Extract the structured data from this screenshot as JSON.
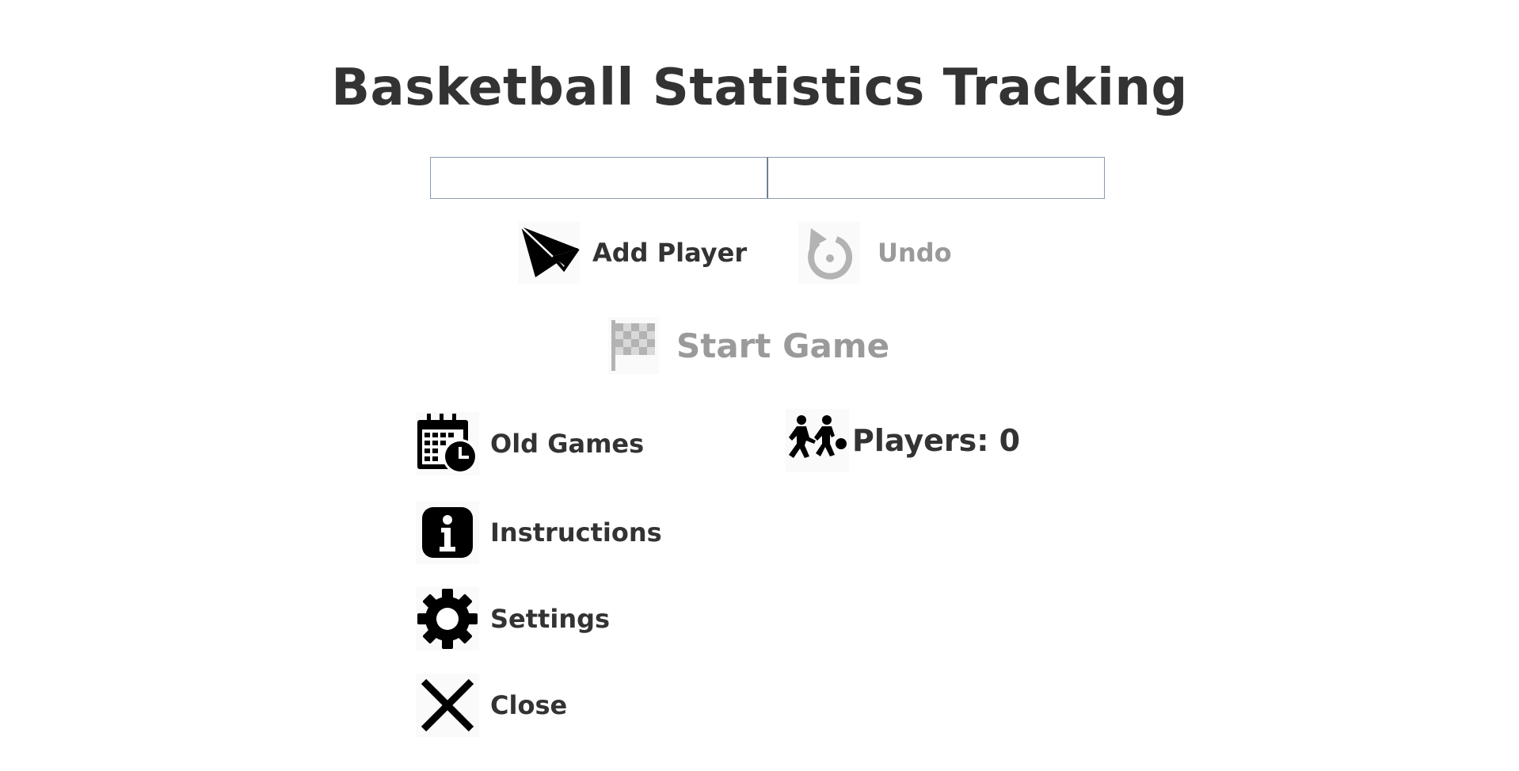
{
  "app": {
    "title": "Basketball Statistics Tracking"
  },
  "inputs": {
    "first": {
      "value": "",
      "placeholder": ""
    },
    "second": {
      "value": "",
      "placeholder": ""
    }
  },
  "actions": {
    "add_player": {
      "label": "Add Player",
      "icon": "paper-plane-icon",
      "enabled": true
    },
    "undo": {
      "label": "Undo",
      "icon": "undo-icon",
      "enabled": false
    },
    "start_game": {
      "label": "Start Game",
      "icon": "checkered-flag-icon",
      "enabled": false
    }
  },
  "menu": {
    "old_games": {
      "label": "Old Games",
      "icon": "calendar-clock-icon"
    },
    "instructions": {
      "label": "Instructions",
      "icon": "info-icon"
    },
    "settings": {
      "label": "Settings",
      "icon": "gear-icon"
    },
    "close": {
      "label": "Close",
      "icon": "close-icon"
    }
  },
  "players": {
    "label": "Players: 0",
    "count": 0,
    "icon": "players-icon"
  },
  "colors": {
    "text": "#333333",
    "disabled": "#9a9a9a",
    "input_border": "#8a9bb0"
  }
}
